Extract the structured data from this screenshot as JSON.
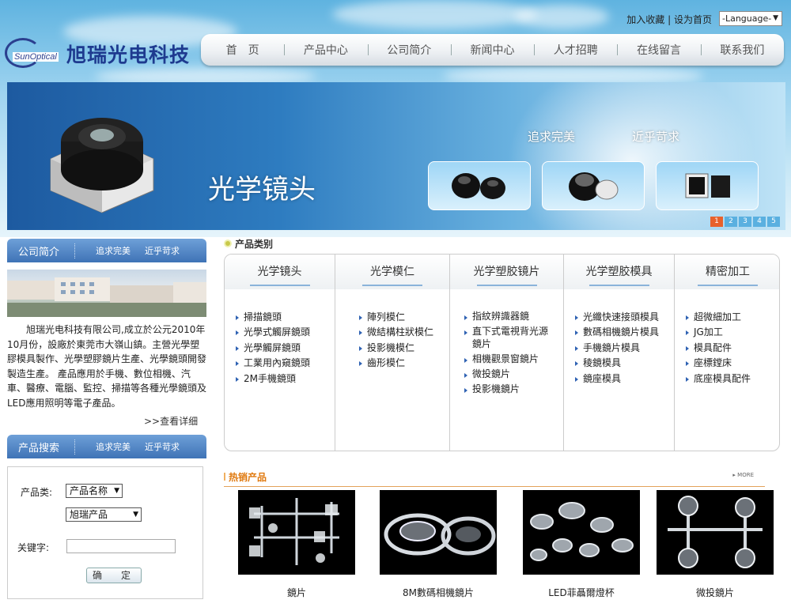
{
  "header": {
    "links": [
      "加入收藏",
      "设为首页"
    ],
    "language_label": "-Language-",
    "logo_en": "SunOptical",
    "logo_cn": "旭瑞光电科技"
  },
  "nav": [
    "首　页",
    "产品中心",
    "公司简介",
    "新闻中心",
    "人才招聘",
    "在线留言",
    "联系我们"
  ],
  "banner": {
    "title": "光学镜头",
    "slogan_1": "追求完美",
    "slogan_2": "近乎苛求",
    "dots": [
      "1",
      "2",
      "3",
      "4",
      "5"
    ],
    "active_dot": 0
  },
  "company_panel": {
    "heading": "公司简介",
    "slogan_1": "追求完美",
    "slogan_2": "近乎苛求",
    "intro": "旭瑞光电科技有限公司,成立於公元2010年10月份，設廠於東莞市大嶺山鎮。主營光學塑膠模具製作、光學塑膠鏡片生產、光學鏡頭開發製造生產。 產品應用於手機、數位相機、汽車、醫療、電腦、監控、掃描等各種光學鏡頭及LED應用照明等電子產品。",
    "more_link": ">>查看详细"
  },
  "search_panel": {
    "heading": "产品搜索",
    "slogan_1": "追求完美",
    "slogan_2": "近乎苛求",
    "category_label": "产品类:",
    "category_value": "产品名称",
    "brand_value": "旭瑞产品",
    "keyword_label": "关键字:",
    "keyword_value": "",
    "submit_label": "确　定"
  },
  "categories": {
    "heading": "产品类别",
    "columns": [
      {
        "title": "光学镜头",
        "items": [
          "掃描鏡頭",
          "光學式觸屏鏡頭",
          "光學觸屏鏡頭",
          "工業用內窺鏡頭",
          "2M手機鏡頭"
        ]
      },
      {
        "title": "光学模仁",
        "items": [
          "陣列模仁",
          "微結構柱狀模仁",
          "投影機模仁",
          "齒形模仁"
        ]
      },
      {
        "title": "光学塑胶镜片",
        "items": [
          "指紋辨識器鏡",
          "直下式電視背光源鏡片",
          "相機觀景窗鏡片",
          "微投鏡片",
          "投影機鏡片"
        ]
      },
      {
        "title": "光学塑胶模具",
        "items": [
          "光纖快速接頭模具",
          "數碼相機鏡片模具",
          "手機鏡片模具",
          "稜鏡模具",
          "鏡座模具"
        ]
      },
      {
        "title": "精密加工",
        "items": [
          "超微細加工",
          "JG加工",
          "模具配件",
          "座標鏜床",
          "底座模具配件"
        ]
      }
    ]
  },
  "hot_products": {
    "heading": "热销产品",
    "more": "MORE",
    "items": [
      {
        "caption": "鏡片"
      },
      {
        "caption": "8M數碼相機鏡片"
      },
      {
        "caption": "LED菲聶爾燈杯"
      },
      {
        "caption": "微投鏡片"
      }
    ]
  }
}
